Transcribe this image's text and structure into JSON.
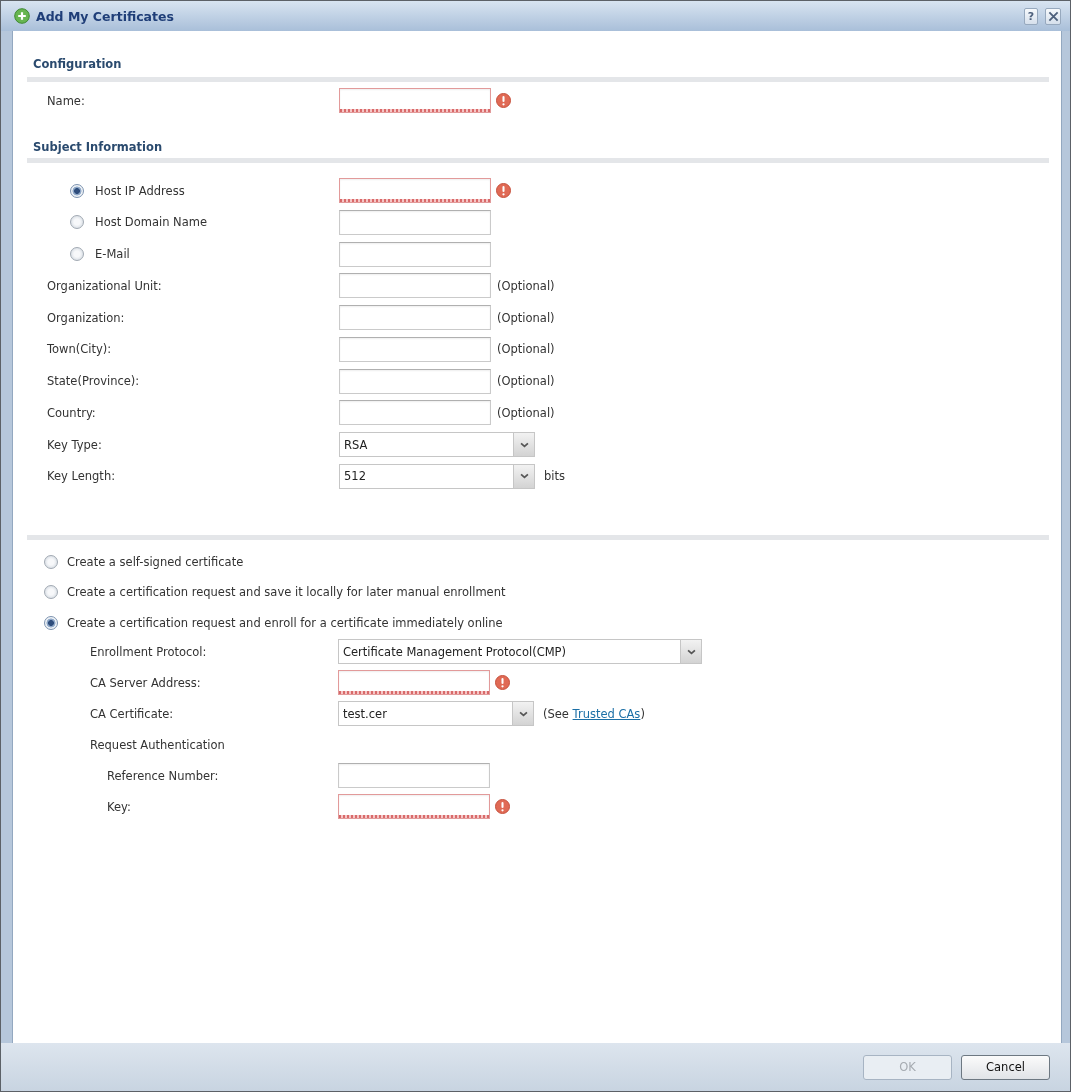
{
  "window": {
    "title": "Add My Certificates",
    "help_label": "?"
  },
  "configuration": {
    "heading": "Configuration",
    "fields": [
      {
        "label": "Name:",
        "kind": "text",
        "error": true
      }
    ]
  },
  "subject_information": {
    "heading": "Subject Information",
    "host_options": [
      {
        "label": "Host IP Address",
        "selected": true,
        "error": true
      },
      {
        "label": "Host Domain Name",
        "selected": false,
        "error": false
      },
      {
        "label": "E-Mail",
        "selected": false,
        "error": false
      }
    ],
    "fields": [
      {
        "label": "Organizational Unit:",
        "kind": "text",
        "error": false,
        "note": "(Optional)"
      },
      {
        "label": "Organization:",
        "kind": "text",
        "error": false,
        "note": "(Optional)"
      },
      {
        "label": "Town(City):",
        "kind": "text",
        "error": false,
        "note": "(Optional)"
      },
      {
        "label": "State(Province):",
        "kind": "text",
        "error": false,
        "note": "(Optional)"
      },
      {
        "label": "Country:",
        "kind": "text",
        "error": false,
        "note": "(Optional)"
      },
      {
        "label": "Key Type:",
        "kind": "select",
        "error": false,
        "value": "RSA"
      },
      {
        "label": "Key Length:",
        "kind": "select",
        "error": false,
        "value": "512",
        "note": "bits"
      }
    ]
  },
  "certificate_options": [
    {
      "label": "Create a self-signed certificate",
      "selected": false
    },
    {
      "label": "Create a certification request and save it locally for later manual enrollment",
      "selected": false
    },
    {
      "label": "Create a certification request and enroll for a certificate immediately online",
      "selected": true
    }
  ],
  "enrollment": {
    "fields": [
      {
        "label": "Enrollment Protocol:",
        "kind": "select",
        "error": false,
        "value": "Certificate Management Protocol(CMP)"
      },
      {
        "label": "CA Server Address:",
        "kind": "text",
        "error": true
      },
      {
        "label": "CA Certificate:",
        "kind": "select",
        "error": false,
        "value": "test.cer",
        "note": "(See",
        "link": "Trusted CAs",
        "note_end": ")"
      }
    ],
    "request_authentication": {
      "heading": "Request Authentication",
      "fields": [
        {
          "label": "Reference Number:",
          "kind": "text",
          "error": false
        },
        {
          "label": "Key:",
          "kind": "text",
          "error": true
        }
      ]
    }
  },
  "footer": {
    "buttons": [
      {
        "label": "OK",
        "disabled": true
      },
      {
        "label": "Cancel",
        "disabled": false
      }
    ]
  }
}
